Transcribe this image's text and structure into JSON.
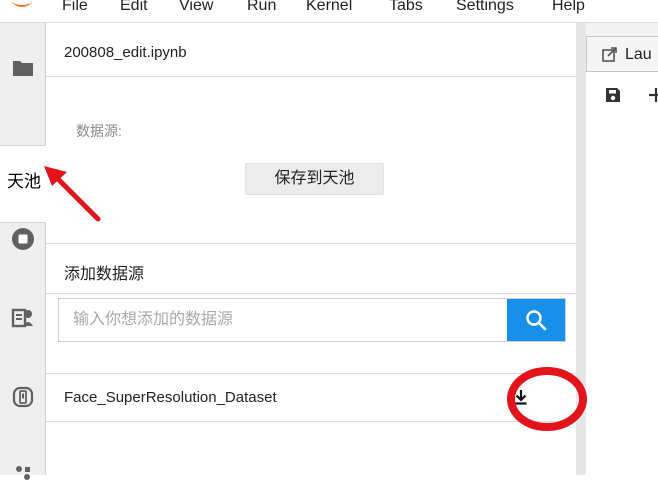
{
  "menu": {
    "items": [
      "File",
      "Edit",
      "View",
      "Run",
      "Kernel",
      "Tabs",
      "Settings",
      "Help"
    ]
  },
  "sidebar": {
    "items": [
      {
        "name": "file-browser",
        "icon": "folder-icon"
      },
      {
        "name": "tianchi",
        "label": "天池"
      },
      {
        "name": "running",
        "icon": "stop-circle-icon"
      },
      {
        "name": "commands",
        "icon": "palette-icon"
      },
      {
        "name": "tabs",
        "icon": "tab-icon"
      },
      {
        "name": "extensions",
        "icon": "extension-icon"
      }
    ]
  },
  "panel": {
    "notebook_name": "200808_edit.ipynb",
    "source_label": "数据源:",
    "save_button": "保存到天池",
    "add_source_title": "添加数据源",
    "search": {
      "placeholder": "输入你想添加的数据源",
      "value": ""
    },
    "datasets": [
      {
        "name": "Face_SuperResolution_Dataset",
        "action_icon": "download-icon"
      }
    ]
  },
  "right": {
    "launcher_tab_label": "Lau",
    "toolbar_icons": [
      "save-icon",
      "plus-icon"
    ]
  },
  "colors": {
    "accent": "#1890ea",
    "annotation": "#e3131b",
    "logo": "#f37726"
  }
}
